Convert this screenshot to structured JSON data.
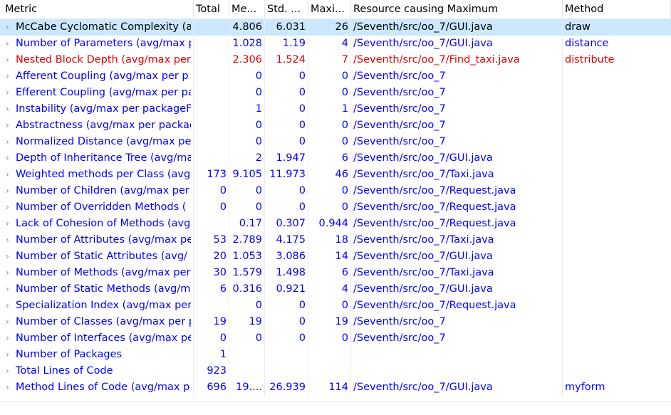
{
  "columns": [
    "Metric",
    "Total",
    "Me...",
    "Std. ...",
    "Maxi...",
    "Resource causing Maximum",
    "Method"
  ],
  "rows": [
    {
      "metric": "McCabe Cyclomatic Complexity (a",
      "total": "",
      "mean": "4.806",
      "std": "6.031",
      "max": "26",
      "resource": "/Seventh/src/oo_7/GUI.java",
      "method": "draw",
      "state": "selected"
    },
    {
      "metric": "Number of Parameters (avg/max p",
      "total": "",
      "mean": "1.028",
      "std": "1.19",
      "max": "4",
      "resource": "/Seventh/src/oo_7/GUI.java",
      "method": "distance",
      "state": "normal"
    },
    {
      "metric": "Nested Block Depth (avg/max per",
      "total": "",
      "mean": "2.306",
      "std": "1.524",
      "max": "7",
      "resource": "/Seventh/src/oo_7/Find_taxi.java",
      "method": "distribute",
      "state": "error"
    },
    {
      "metric": "Afferent Coupling (avg/max per p",
      "total": "",
      "mean": "0",
      "std": "0",
      "max": "0",
      "resource": "/Seventh/src/oo_7",
      "method": "",
      "state": "normal"
    },
    {
      "metric": "Efferent Coupling (avg/max per pa",
      "total": "",
      "mean": "0",
      "std": "0",
      "max": "0",
      "resource": "/Seventh/src/oo_7",
      "method": "",
      "state": "normal"
    },
    {
      "metric": "Instability (avg/max per packageFi",
      "total": "",
      "mean": "1",
      "std": "0",
      "max": "1",
      "resource": "/Seventh/src/oo_7",
      "method": "",
      "state": "normal"
    },
    {
      "metric": "Abstractness (avg/max per packag",
      "total": "",
      "mean": "0",
      "std": "0",
      "max": "0",
      "resource": "/Seventh/src/oo_7",
      "method": "",
      "state": "normal"
    },
    {
      "metric": "Normalized Distance (avg/max pe",
      "total": "",
      "mean": "0",
      "std": "0",
      "max": "0",
      "resource": "/Seventh/src/oo_7",
      "method": "",
      "state": "normal"
    },
    {
      "metric": "Depth of Inheritance Tree (avg/ma",
      "total": "",
      "mean": "2",
      "std": "1.947",
      "max": "6",
      "resource": "/Seventh/src/oo_7/GUI.java",
      "method": "",
      "state": "normal"
    },
    {
      "metric": "Weighted methods per Class (avg",
      "total": "173",
      "mean": "9.105",
      "std": "11.973",
      "max": "46",
      "resource": "/Seventh/src/oo_7/Taxi.java",
      "method": "",
      "state": "normal"
    },
    {
      "metric": "Number of Children (avg/max per",
      "total": "0",
      "mean": "0",
      "std": "0",
      "max": "0",
      "resource": "/Seventh/src/oo_7/Request.java",
      "method": "",
      "state": "normal"
    },
    {
      "metric": "Number of Overridden Methods (",
      "total": "0",
      "mean": "0",
      "std": "0",
      "max": "0",
      "resource": "/Seventh/src/oo_7/Request.java",
      "method": "",
      "state": "normal"
    },
    {
      "metric": "Lack of Cohesion of Methods (avg",
      "total": "",
      "mean": "0.17",
      "std": "0.307",
      "max": "0.944",
      "resource": "/Seventh/src/oo_7/Request.java",
      "method": "",
      "state": "normal"
    },
    {
      "metric": "Number of Attributes (avg/max pe",
      "total": "53",
      "mean": "2.789",
      "std": "4.175",
      "max": "18",
      "resource": "/Seventh/src/oo_7/Taxi.java",
      "method": "",
      "state": "normal"
    },
    {
      "metric": "Number of Static Attributes (avg/",
      "total": "20",
      "mean": "1.053",
      "std": "3.086",
      "max": "14",
      "resource": "/Seventh/src/oo_7/GUI.java",
      "method": "",
      "state": "normal"
    },
    {
      "metric": "Number of Methods (avg/max per",
      "total": "30",
      "mean": "1.579",
      "std": "1.498",
      "max": "6",
      "resource": "/Seventh/src/oo_7/Taxi.java",
      "method": "",
      "state": "normal"
    },
    {
      "metric": "Number of Static Methods (avg/m",
      "total": "6",
      "mean": "0.316",
      "std": "0.921",
      "max": "4",
      "resource": "/Seventh/src/oo_7/GUI.java",
      "method": "",
      "state": "normal"
    },
    {
      "metric": "Specialization Index (avg/max per",
      "total": "",
      "mean": "0",
      "std": "0",
      "max": "0",
      "resource": "/Seventh/src/oo_7/Request.java",
      "method": "",
      "state": "normal"
    },
    {
      "metric": "Number of Classes (avg/max per p",
      "total": "19",
      "mean": "19",
      "std": "0",
      "max": "19",
      "resource": "/Seventh/src/oo_7",
      "method": "",
      "state": "normal"
    },
    {
      "metric": "Number of Interfaces (avg/max pe",
      "total": "0",
      "mean": "0",
      "std": "0",
      "max": "0",
      "resource": "/Seventh/src/oo_7",
      "method": "",
      "state": "normal"
    },
    {
      "metric": "Number of Packages",
      "total": "1",
      "mean": "",
      "std": "",
      "max": "",
      "resource": "",
      "method": "",
      "state": "normal"
    },
    {
      "metric": "Total Lines of Code",
      "total": "923",
      "mean": "",
      "std": "",
      "max": "",
      "resource": "",
      "method": "",
      "state": "normal"
    },
    {
      "metric": "Method Lines of Code (avg/max p",
      "total": "696",
      "mean": "19....",
      "std": "26.939",
      "max": "114",
      "resource": "/Seventh/src/oo_7/GUI.java",
      "method": "myform",
      "state": "normal"
    }
  ],
  "icons": {
    "expand": "chevron-right-icon"
  },
  "colors": {
    "text": "#0000ff",
    "error": "#e00000",
    "selected_bg": "#cce8ff",
    "header_text": "#000000"
  }
}
